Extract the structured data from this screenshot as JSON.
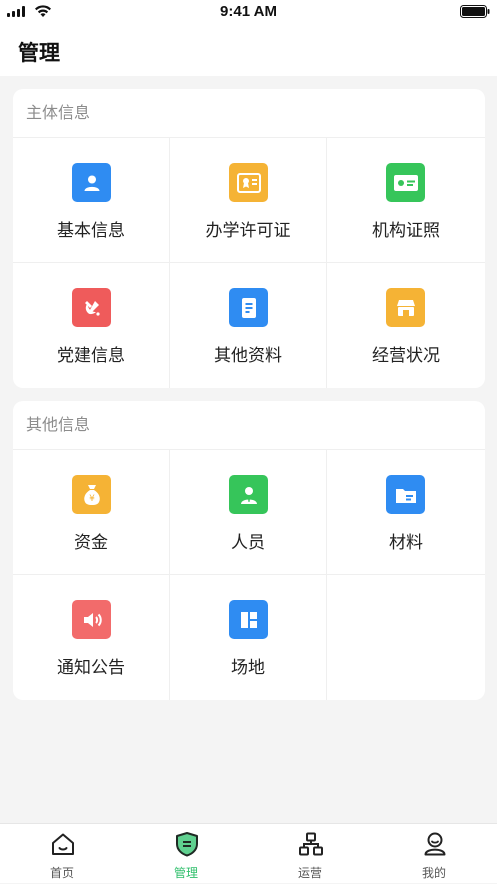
{
  "status_bar": {
    "time": "9:41 AM"
  },
  "header": {
    "title": "管理"
  },
  "sections": [
    {
      "title": "主体信息",
      "items": [
        {
          "label": "基本信息",
          "icon": "user-card-icon",
          "color": "#2f8cf2"
        },
        {
          "label": "办学许可证",
          "icon": "certificate-icon",
          "color": "#f5b335"
        },
        {
          "label": "机构证照",
          "icon": "id-card-icon",
          "color": "#36c55a"
        },
        {
          "label": "党建信息",
          "icon": "party-emblem-icon",
          "color": "#ef5b5b"
        },
        {
          "label": "其他资料",
          "icon": "document-icon",
          "color": "#2f8cf2"
        },
        {
          "label": "经营状况",
          "icon": "store-icon",
          "color": "#f5b335"
        }
      ]
    },
    {
      "title": "其他信息",
      "items": [
        {
          "label": "资金",
          "icon": "money-bag-icon",
          "color": "#f5b335"
        },
        {
          "label": "人员",
          "icon": "person-icon",
          "color": "#36c55a"
        },
        {
          "label": "材料",
          "icon": "folder-icon",
          "color": "#2f8cf2"
        },
        {
          "label": "通知公告",
          "icon": "speaker-icon",
          "color": "#f26b6b"
        },
        {
          "label": "场地",
          "icon": "layout-icon",
          "color": "#2f8cf2"
        }
      ]
    }
  ],
  "tabbar": {
    "tabs": [
      {
        "label": "首页",
        "icon": "home-icon"
      },
      {
        "label": "管理",
        "icon": "shield-icon",
        "active": true
      },
      {
        "label": "运营",
        "icon": "org-chart-icon"
      },
      {
        "label": "我的",
        "icon": "profile-icon"
      }
    ],
    "active_color": "#2fbf6b"
  }
}
